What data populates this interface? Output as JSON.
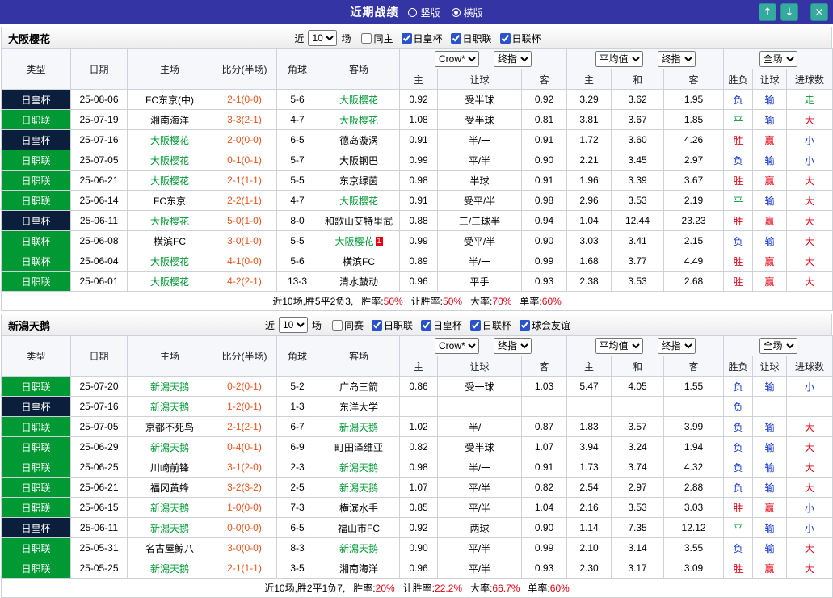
{
  "header": {
    "title": "近期战绩",
    "view_options": [
      {
        "label": "竖版",
        "selected": false
      },
      {
        "label": "横版",
        "selected": true
      }
    ],
    "icons": {
      "up": "↑",
      "down": "↓",
      "close": "×"
    }
  },
  "table": {
    "left_headers": [
      "类型",
      "日期",
      "主场",
      "比分(半场)",
      "角球",
      "客场"
    ],
    "selects": {
      "source": "Crow*",
      "final1": "终指",
      "avg": "平均值",
      "final2": "终指",
      "scope": "全场"
    },
    "sub_headers": [
      "主",
      "让球",
      "客",
      "主",
      "和",
      "客",
      "胜负",
      "让球",
      "进球数"
    ]
  },
  "filters_common": {
    "prefix": "近",
    "suffix": "场"
  },
  "colors": {
    "topbar_bg": "#3434a4",
    "tool_button_bg": "#35ab9f",
    "team_highlight": "#009933",
    "score_text": "#e8541e",
    "summary_value": "#e60012",
    "league": {
      "日皇杯": "#0b1e3c",
      "日职联": "#009933",
      "日联杯": "#009933"
    },
    "result": {
      "胜": "#e60012",
      "赢": "#e60012",
      "大": "#e60012",
      "平": "#009933",
      "走": "#009933",
      "负": "#1536c8",
      "输": "#1536c8",
      "小": "#1536c8"
    }
  },
  "sections": [
    {
      "team": "大阪樱花",
      "filters": {
        "count": "10",
        "same_label": "同主",
        "leagues": [
          "日皇杯",
          "日职联",
          "日联杯"
        ]
      },
      "rows": [
        {
          "league": "日皇杯",
          "date": "25-08-06",
          "home": "FC东京(中)",
          "score": "2-1(0-0)",
          "corner": "5-6",
          "away": "大阪樱花",
          "odds": [
            "0.92",
            "受半球",
            "0.92",
            "3.29",
            "3.62",
            "1.95"
          ],
          "results": [
            "负",
            "输",
            "走"
          ]
        },
        {
          "league": "日职联",
          "date": "25-07-19",
          "home": "湘南海洋",
          "score": "3-3(2-1)",
          "corner": "4-7",
          "away": "大阪樱花",
          "odds": [
            "1.08",
            "受半球",
            "0.81",
            "3.81",
            "3.67",
            "1.85"
          ],
          "results": [
            "平",
            "输",
            "大"
          ]
        },
        {
          "league": "日皇杯",
          "date": "25-07-16",
          "home": "大阪樱花",
          "score": "2-0(0-0)",
          "corner": "6-5",
          "away": "德岛漩涡",
          "odds": [
            "0.91",
            "半/一",
            "0.91",
            "1.72",
            "3.60",
            "4.26"
          ],
          "results": [
            "胜",
            "赢",
            "小"
          ]
        },
        {
          "league": "日职联",
          "date": "25-07-05",
          "home": "大阪樱花",
          "score": "0-1(0-1)",
          "corner": "5-7",
          "away": "大阪钢巴",
          "odds": [
            "0.99",
            "平/半",
            "0.90",
            "2.21",
            "3.45",
            "2.97"
          ],
          "results": [
            "负",
            "输",
            "小"
          ]
        },
        {
          "league": "日职联",
          "date": "25-06-21",
          "home": "大阪樱花",
          "score": "2-1(1-1)",
          "corner": "5-5",
          "away": "东京绿茵",
          "odds": [
            "0.98",
            "半球",
            "0.91",
            "1.96",
            "3.39",
            "3.67"
          ],
          "results": [
            "胜",
            "赢",
            "大"
          ]
        },
        {
          "league": "日职联",
          "date": "25-06-14",
          "home": "FC东京",
          "score": "2-2(1-1)",
          "corner": "4-7",
          "away": "大阪樱花",
          "odds": [
            "0.91",
            "受平/半",
            "0.98",
            "2.96",
            "3.53",
            "2.19"
          ],
          "results": [
            "平",
            "输",
            "大"
          ]
        },
        {
          "league": "日皇杯",
          "date": "25-06-11",
          "home": "大阪樱花",
          "score": "5-0(1-0)",
          "corner": "8-0",
          "away": "和歌山艾特里武",
          "odds": [
            "0.88",
            "三/三球半",
            "0.94",
            "1.04",
            "12.44",
            "23.23"
          ],
          "results": [
            "胜",
            "赢",
            "大"
          ]
        },
        {
          "league": "日联杯",
          "date": "25-06-08",
          "home": "横滨FC",
          "score": "3-0(1-0)",
          "corner": "5-5",
          "away": "大阪樱花",
          "away_badge": "1",
          "odds": [
            "0.99",
            "受平/半",
            "0.90",
            "3.03",
            "3.41",
            "2.15"
          ],
          "results": [
            "负",
            "输",
            "大"
          ]
        },
        {
          "league": "日联杯",
          "date": "25-06-04",
          "home": "大阪樱花",
          "score": "4-1(0-0)",
          "corner": "5-6",
          "away": "横滨FC",
          "odds": [
            "0.89",
            "半/一",
            "0.99",
            "1.68",
            "3.77",
            "4.49"
          ],
          "results": [
            "胜",
            "赢",
            "大"
          ]
        },
        {
          "league": "日职联",
          "date": "25-06-01",
          "home": "大阪樱花",
          "score": "4-2(2-1)",
          "corner": "13-3",
          "away": "清水鼓动",
          "odds": [
            "0.96",
            "平手",
            "0.93",
            "2.38",
            "3.53",
            "2.68"
          ],
          "results": [
            "胜",
            "赢",
            "大"
          ]
        }
      ],
      "summary": {
        "prefix": "近10场,胜5平2负3,",
        "stats": [
          {
            "label": "胜率:",
            "value": "50%"
          },
          {
            "label": "让胜率:",
            "value": "50%"
          },
          {
            "label": "大率:",
            "value": "70%"
          },
          {
            "label": "单率:",
            "value": "60%"
          }
        ]
      }
    },
    {
      "team": "新潟天鹅",
      "filters": {
        "count": "10",
        "same_label": "同赛",
        "leagues": [
          "日职联",
          "日皇杯",
          "日联杯",
          "球会友谊"
        ]
      },
      "rows": [
        {
          "league": "日职联",
          "date": "25-07-20",
          "home": "新潟天鹅",
          "score": "0-2(0-1)",
          "corner": "5-2",
          "away": "广岛三箭",
          "odds": [
            "0.86",
            "受一球",
            "1.03",
            "5.47",
            "4.05",
            "1.55"
          ],
          "results": [
            "负",
            "输",
            "小"
          ]
        },
        {
          "league": "日皇杯",
          "date": "25-07-16",
          "home": "新潟天鹅",
          "score": "1-2(0-1)",
          "corner": "1-3",
          "away": "东洋大学",
          "odds": [
            "",
            "",
            "",
            "",
            "",
            ""
          ],
          "results": [
            "负",
            "",
            ""
          ]
        },
        {
          "league": "日职联",
          "date": "25-07-05",
          "home": "京都不死鸟",
          "score": "2-1(2-1)",
          "corner": "6-7",
          "away": "新潟天鹅",
          "odds": [
            "1.02",
            "半/一",
            "0.87",
            "1.83",
            "3.57",
            "3.99"
          ],
          "results": [
            "负",
            "输",
            "大"
          ]
        },
        {
          "league": "日职联",
          "date": "25-06-29",
          "home": "新潟天鹅",
          "score": "0-4(0-1)",
          "corner": "6-9",
          "away": "町田泽维亚",
          "odds": [
            "0.82",
            "受半球",
            "1.07",
            "3.94",
            "3.24",
            "1.94"
          ],
          "results": [
            "负",
            "输",
            "大"
          ]
        },
        {
          "league": "日职联",
          "date": "25-06-25",
          "home": "川崎前锋",
          "score": "3-1(2-0)",
          "corner": "2-3",
          "away": "新潟天鹅",
          "odds": [
            "0.98",
            "半/一",
            "0.91",
            "1.73",
            "3.74",
            "4.32"
          ],
          "results": [
            "负",
            "输",
            "大"
          ]
        },
        {
          "league": "日职联",
          "date": "25-06-21",
          "home": "福冈黄蜂",
          "score": "3-2(3-2)",
          "corner": "2-5",
          "away": "新潟天鹅",
          "odds": [
            "1.07",
            "平/半",
            "0.82",
            "2.54",
            "2.97",
            "2.88"
          ],
          "results": [
            "负",
            "输",
            "大"
          ]
        },
        {
          "league": "日职联",
          "date": "25-06-15",
          "home": "新潟天鹅",
          "score": "1-0(0-0)",
          "corner": "7-3",
          "away": "横滨水手",
          "odds": [
            "0.85",
            "平/半",
            "1.04",
            "2.16",
            "3.53",
            "3.03"
          ],
          "results": [
            "胜",
            "赢",
            "小"
          ]
        },
        {
          "league": "日皇杯",
          "date": "25-06-11",
          "home": "新潟天鹅",
          "score": "0-0(0-0)",
          "corner": "6-5",
          "away": "福山市FC",
          "odds": [
            "0.92",
            "两球",
            "0.90",
            "1.14",
            "7.35",
            "12.12"
          ],
          "results": [
            "平",
            "输",
            "小"
          ]
        },
        {
          "league": "日职联",
          "date": "25-05-31",
          "home": "名古屋鲸八",
          "score": "3-0(0-0)",
          "corner": "8-3",
          "away": "新潟天鹅",
          "odds": [
            "0.90",
            "平/半",
            "0.99",
            "2.10",
            "3.14",
            "3.55"
          ],
          "results": [
            "负",
            "输",
            "大"
          ]
        },
        {
          "league": "日职联",
          "date": "25-05-25",
          "home": "新潟天鹅",
          "score": "2-1(1-1)",
          "corner": "3-5",
          "away": "湘南海洋",
          "odds": [
            "0.96",
            "平/半",
            "0.93",
            "2.30",
            "3.17",
            "3.09"
          ],
          "results": [
            "胜",
            "赢",
            "大"
          ]
        }
      ],
      "summary": {
        "prefix": "近10场,胜2平1负7,",
        "stats": [
          {
            "label": "胜率:",
            "value": "20%"
          },
          {
            "label": "让胜率:",
            "value": "22.2%"
          },
          {
            "label": "大率:",
            "value": "66.7%"
          },
          {
            "label": "单率:",
            "value": "60%"
          }
        ]
      }
    }
  ]
}
